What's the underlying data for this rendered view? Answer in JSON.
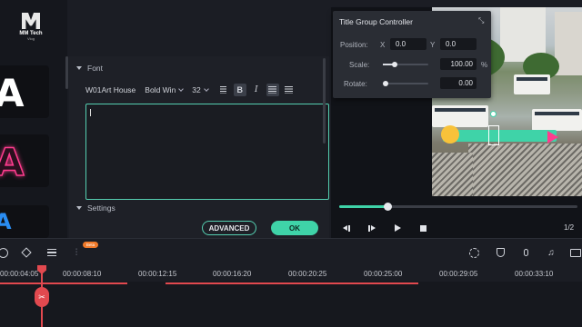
{
  "brand": {
    "name": "MM Tech",
    "sub": "Vlog"
  },
  "presets": [
    {
      "glyph": "A"
    },
    {
      "glyph": "A"
    },
    {
      "glyph": "A"
    }
  ],
  "editor": {
    "font_section": "Font",
    "settings_section": "Settings",
    "font_family": "W01Art House",
    "font_weight": "Bold Win",
    "font_size": "32",
    "bold_label": "B",
    "italic_label": "I",
    "text_value": ""
  },
  "actions": {
    "advanced_label": "ADVANCED",
    "ok_label": "OK"
  },
  "controller": {
    "title": "Title Group Controller",
    "position_label": "Position:",
    "x_label": "X",
    "x_value": "0.0",
    "y_label": "Y",
    "y_value": "0.0",
    "scale_label": "Scale:",
    "scale_value": "100.00",
    "scale_unit": "%",
    "scale_slider_fraction": 0.25,
    "rotate_label": "Rotate:",
    "rotate_value": "0.00",
    "rotate_slider_fraction": 0.0
  },
  "player": {
    "progress_fraction": 0.2,
    "page_indicator": "1/2"
  },
  "timeline": {
    "beta_badge": "Beta",
    "ticks": [
      "00:00:04:05",
      "00:00:08:10",
      "00:00:12:15",
      "00:00:16:20",
      "00:00:20:25",
      "00:00:25:00",
      "00:00:29:05",
      "00:00:33:10"
    ]
  },
  "colors": {
    "accent": "#3fd3a8",
    "playhead": "#e2494f",
    "beta": "#f07a2a"
  }
}
